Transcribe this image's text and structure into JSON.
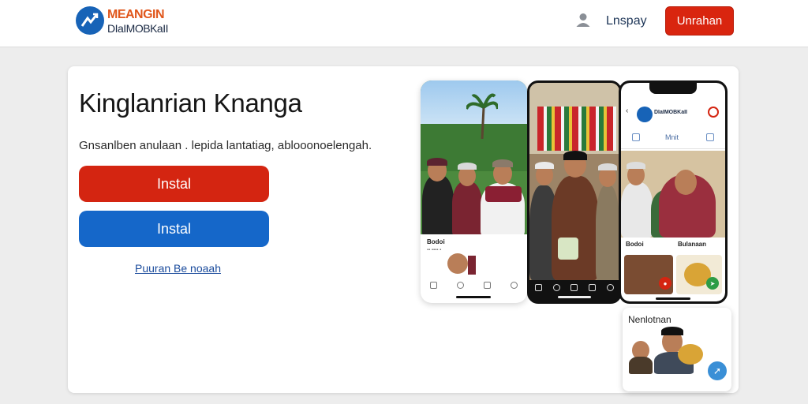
{
  "header": {
    "logo_line1": "MEANGIN",
    "logo_line2": "DIaIMOBKaII",
    "login_label": "Lnspay",
    "signup_label": "Unrahan"
  },
  "hero": {
    "title": "Kinglanrian Knanga",
    "subtitle": "Gnsanlben anulaan . lepida lantatiag, ablooonoelengah.",
    "primary_button": "Instal",
    "secondary_button": "Instal",
    "link": "Puuran Be noaah"
  },
  "phones": {
    "phone_a": {
      "caption": "Bodoi"
    },
    "phone_c": {
      "logo_text": "DIaIMOBKaII",
      "tab_label": "Mnit",
      "caption_left": "Bodoi",
      "caption_right": "Bulanaan"
    }
  },
  "popup": {
    "title": "Nenlotnan"
  },
  "colors": {
    "brand_red": "#d42511",
    "brand_blue": "#1567c9",
    "link_blue": "#1a4b9c"
  }
}
